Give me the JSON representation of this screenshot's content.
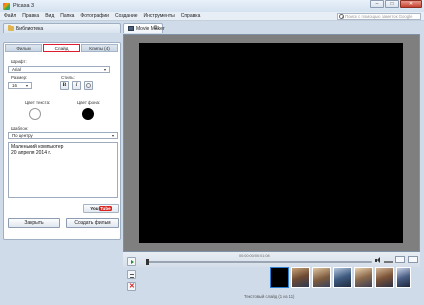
{
  "window": {
    "title": "Picasa 3",
    "minimize": "–",
    "maximize": "□",
    "close": "✕"
  },
  "menu": {
    "items": [
      "Файл",
      "Правка",
      "Вид",
      "Папка",
      "Фотографии",
      "Создание",
      "Инструменты",
      "Справка"
    ],
    "search_placeholder": "Поиск с помощью заметок Google"
  },
  "tabs": {
    "library": "Библиотека",
    "movie_maker": "Movie Maker",
    "movie_maker_close": "⧉"
  },
  "left_panel": {
    "tabs": [
      "Фильм",
      "Слайд",
      "Клипы (4)"
    ],
    "active_tab": "Слайд",
    "font_label": "Шрифт:",
    "font_value": "Arial",
    "size_label": "Размер:",
    "size_value": "16",
    "style_label": "Стиль:",
    "bold": "B",
    "italic": "I",
    "text_color_label": "Цвет текста:",
    "bg_color_label": "Цвет фона:",
    "template_label": "Шаблон:",
    "template_value": "По центру",
    "slide_text": "Маленький компьютер\n20 апреля 2014 г.",
    "youtube_you": "You",
    "youtube_tube": "Tube",
    "close_button": "Закрыть",
    "create_button": "Создать фильм"
  },
  "player": {
    "time": "00:00:00/00:01:08",
    "slide_info": "Текстовый слайд    (1 из 11)"
  },
  "colors": {
    "text_color": "#ffffff",
    "bg_color": "#000000",
    "active_tab_border": "#e11b2f",
    "selected_thumb_border": "#2f7fd0"
  }
}
